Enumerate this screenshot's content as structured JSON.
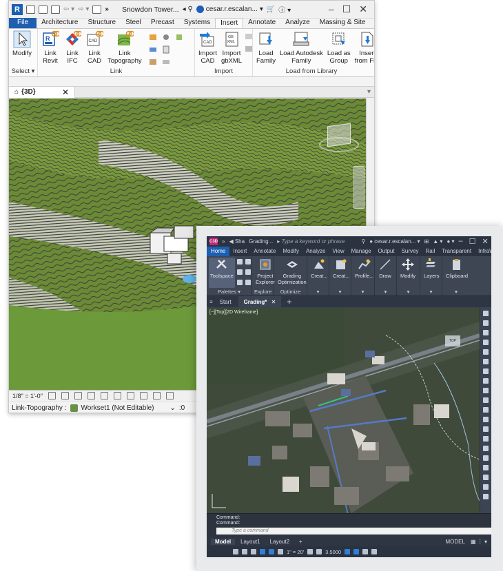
{
  "revit": {
    "app_logo": "R",
    "doc_title": "Snowdon Tower...",
    "user": "cesar.r.escalan...",
    "tabs": [
      "File",
      "Architecture",
      "Structure",
      "Steel",
      "Precast",
      "Systems",
      "Insert",
      "Annotate",
      "Analyze",
      "Massing & Site"
    ],
    "active_tab": "Insert",
    "panels": {
      "select": {
        "modify_label": "Modify",
        "title": "Select ▾"
      },
      "link": {
        "title": "Link",
        "buttons": [
          {
            "label": "Link\nRevit",
            "icon": "revit-link-icon"
          },
          {
            "label": "Link\nIFC",
            "icon": "ifc-link-icon"
          },
          {
            "label": "Link\nCAD",
            "icon": "cad-link-icon"
          },
          {
            "label": "Link\nTopography",
            "icon": "topography-link-icon"
          }
        ]
      },
      "import": {
        "title": "Import",
        "buttons": [
          {
            "label": "Import\nCAD",
            "icon": "import-cad-icon"
          },
          {
            "label": "Import\ngbXML",
            "icon": "import-gbxml-icon"
          }
        ]
      },
      "load_from_library": {
        "title": "Load from Library",
        "buttons": [
          {
            "label": "Load\nFamily",
            "icon": "load-family-icon"
          },
          {
            "label": "Load Autodesk\nFamily",
            "icon": "load-autodesk-family-icon"
          },
          {
            "label": "Load as\nGroup",
            "icon": "load-group-icon"
          },
          {
            "label": "Insert\nfrom File",
            "icon": "insert-file-icon"
          }
        ]
      }
    },
    "view_tab": {
      "label": "{3D}",
      "close": "✕"
    },
    "status": {
      "scale": "1/8\" = 1'-0\""
    },
    "footer": {
      "text": "Link-Topography :",
      "workset": "Workset1 (Not Editable)",
      "count": ":0"
    }
  },
  "civil": {
    "logo": "C3D",
    "share": "Sha",
    "doc": "Grading...",
    "search_placeholder": "Type a keyword or phrase",
    "user": "cesar.r.escalan...",
    "tabs": [
      "Home",
      "Insert",
      "Annotate",
      "Modify",
      "Analyze",
      "View",
      "Manage",
      "Output",
      "Survey",
      "Rail",
      "Transparent",
      "InfraWorks"
    ],
    "active_tab": "Home",
    "panels": [
      {
        "title": "Palettes ▾",
        "buttons": [
          {
            "label": "Toolspace",
            "icon": "toolspace-icon",
            "selected": true
          }
        ]
      },
      {
        "title": "Explore",
        "buttons": [
          {
            "label": "Project\nExplorer",
            "icon": "project-explorer-icon"
          }
        ]
      },
      {
        "title": "Optimize",
        "buttons": [
          {
            "label": "Grading\nOptimization",
            "icon": "grading-optimization-icon"
          }
        ]
      },
      {
        "title": "▾",
        "buttons": [
          {
            "label": "Creat...",
            "icon": "create-ground-icon"
          }
        ]
      },
      {
        "title": "▾",
        "buttons": [
          {
            "label": "Creat...",
            "icon": "create-design-icon"
          }
        ]
      },
      {
        "title": "▾",
        "buttons": [
          {
            "label": "Profile...",
            "icon": "profile-icon"
          }
        ]
      },
      {
        "title": "▾",
        "buttons": [
          {
            "label": "Draw",
            "icon": "draw-icon"
          }
        ]
      },
      {
        "title": "▾",
        "buttons": [
          {
            "label": "Modify",
            "icon": "modify-move-icon"
          }
        ]
      },
      {
        "title": "▾",
        "buttons": [
          {
            "label": "Layers",
            "icon": "layers-icon"
          }
        ]
      },
      {
        "title": "▾",
        "buttons": [
          {
            "label": "Clipboard",
            "icon": "clipboard-icon"
          }
        ]
      }
    ],
    "doc_tabs": {
      "start": "Start",
      "active": "Grading*",
      "close": "✕",
      "plus": "+"
    },
    "viewport_label": "[−][Top][2D Wireframe]",
    "viewcube_top": "TOP",
    "command": {
      "line1": "Command:",
      "line2": "Command:",
      "placeholder": "Type a command"
    },
    "layouts": {
      "model": "Model",
      "layout1": "Layout1",
      "layout2": "Layout2",
      "plus": "+",
      "mode": "MODEL"
    },
    "status": {
      "scale": "1\" = 20'",
      "value": "3.5000"
    }
  }
}
